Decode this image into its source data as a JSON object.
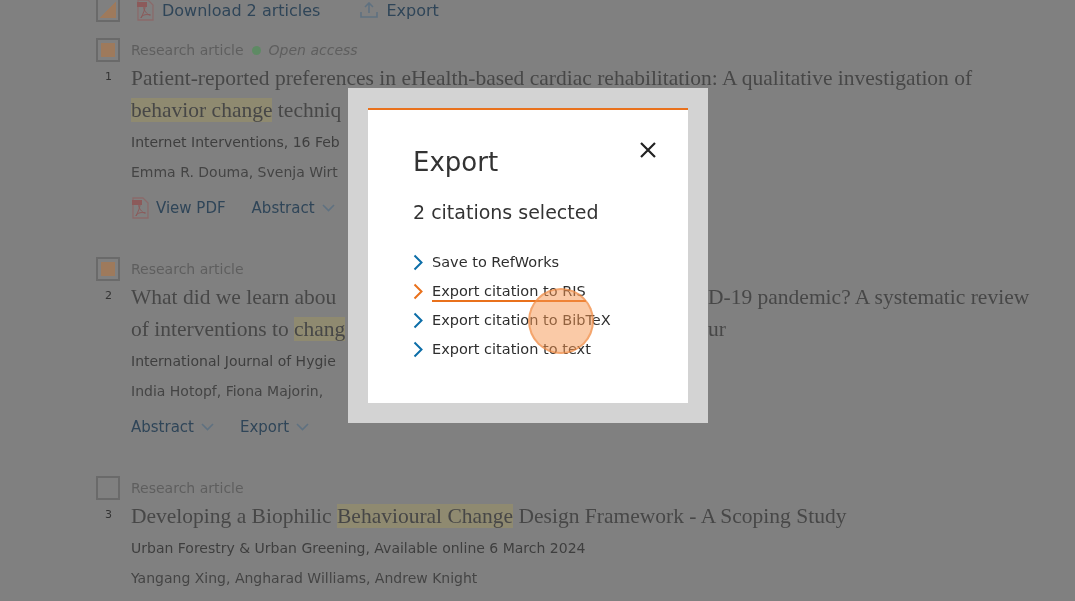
{
  "toolbar": {
    "select_all": {
      "checked": true
    },
    "download": "Download 2 articles",
    "export": "Export"
  },
  "articles": [
    {
      "selected": true,
      "number": "1",
      "type": "Research article",
      "open_access": "Open access",
      "title_lines": [
        {
          "segments": [
            {
              "text": "Patient-reported preferences in eHealth-based cardiac rehabilitation: A qualitative investigation of",
              "highlight": false
            }
          ]
        },
        {
          "segments": [
            {
              "text": "behavior change",
              "highlight": true
            },
            {
              "text": " techniq",
              "highlight": false
            }
          ]
        }
      ],
      "journal": "Internet Interventions, 16 Feb",
      "authors": "Emma R. Douma, Svenja Wirt",
      "actions": [
        {
          "kind": "pdf",
          "label": "View PDF"
        },
        {
          "kind": "dropdown",
          "label": "Abstract"
        }
      ]
    },
    {
      "selected": true,
      "number": "2",
      "type": "Research article",
      "title_lines": [
        {
          "segments": [
            {
              "text": "What did we learn abou",
              "highlight": false
            }
          ],
          "right": "D-19 pandemic? A systematic review"
        },
        {
          "segments": [
            {
              "text": "of interventions to ",
              "highlight": false
            },
            {
              "text": "chang",
              "highlight": true
            }
          ],
          "right": "ur"
        }
      ],
      "journal": "International Journal of Hygie",
      "authors": "India Hotopf, Fiona Majorin,",
      "actions": [
        {
          "kind": "dropdown",
          "label": "Abstract"
        },
        {
          "kind": "dropdown",
          "label": "Export"
        }
      ]
    },
    {
      "selected": false,
      "number": "3",
      "type": "Research article",
      "title_lines": [
        {
          "segments": [
            {
              "text": "Developing a Biophilic ",
              "highlight": false
            },
            {
              "text": "Behavioural Change",
              "highlight": true
            },
            {
              "text": " Design Framework - A Scoping Study",
              "highlight": false
            }
          ]
        }
      ],
      "journal": "Urban Forestry & Urban Greening, Available online 6 March 2024",
      "authors": "Yangang Xing, Angharad Williams, Andrew Knight"
    }
  ],
  "modal": {
    "title": "Export",
    "subtitle": "2 citations selected",
    "options": [
      {
        "label": "Save to RefWorks",
        "selected": false
      },
      {
        "label": "Export citation to RIS",
        "selected": true
      },
      {
        "label": "Export citation to BibTeX",
        "selected": false
      },
      {
        "label": "Export citation to text",
        "selected": false
      }
    ]
  }
}
